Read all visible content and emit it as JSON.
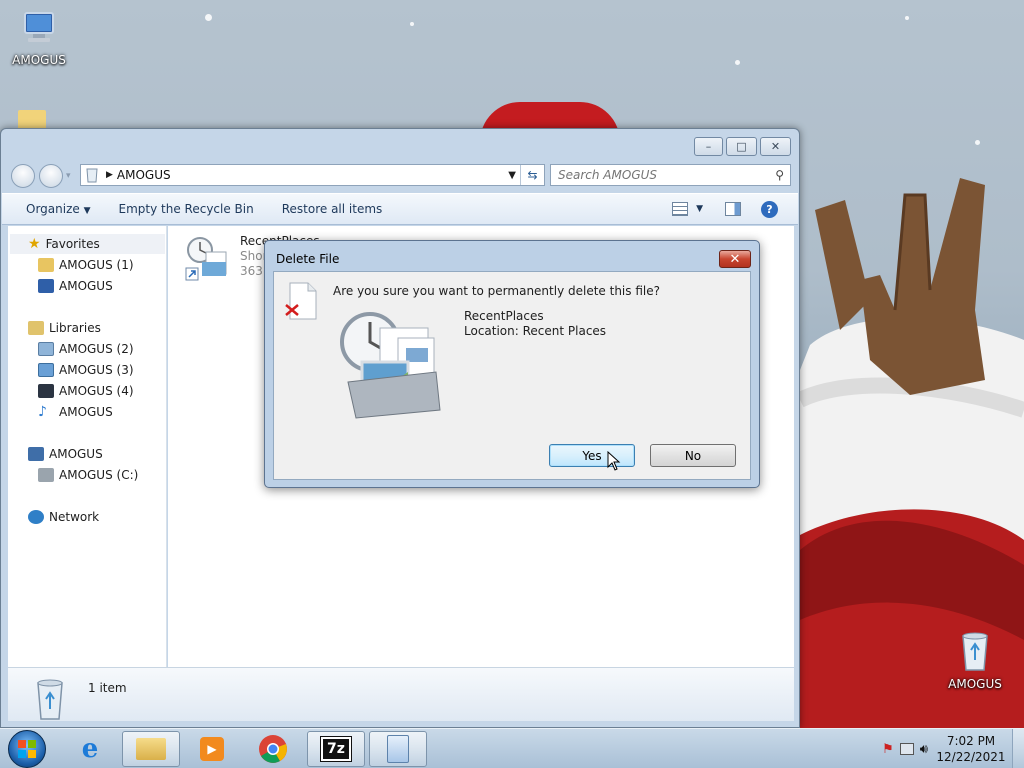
{
  "desktop": {
    "icons": [
      {
        "label": "AMOGUS",
        "kind": "computer"
      },
      {
        "label": "AMOGUS",
        "kind": "recycle-bin"
      }
    ]
  },
  "window": {
    "controls": {
      "minimize": "–",
      "maximize": "□",
      "close": "✕"
    },
    "address": {
      "breadcrumb": "AMOGUS"
    },
    "search": {
      "placeholder": "Search AMOGUS"
    },
    "commands": {
      "organize": "Organize",
      "empty_bin": "Empty the Recycle Bin",
      "restore_all": "Restore all items"
    },
    "nav": {
      "favorites": {
        "label": "Favorites",
        "items": [
          "AMOGUS (1)",
          "AMOGUS"
        ]
      },
      "libraries": {
        "label": "Libraries",
        "items": [
          "AMOGUS (2)",
          "AMOGUS (3)",
          "AMOGUS (4)",
          "AMOGUS"
        ]
      },
      "computer": {
        "label": "AMOGUS",
        "items": [
          "AMOGUS (C:)"
        ]
      },
      "network": {
        "label": "Network"
      }
    },
    "file": {
      "name": "RecentPlaces",
      "type": "Shorc",
      "size": "363 b"
    },
    "status": {
      "count": "1 item"
    }
  },
  "dialog": {
    "title": "Delete File",
    "close": "✕",
    "question": "Are you sure you want to permanently delete this file?",
    "file_name": "RecentPlaces",
    "location": "Location: Recent Places",
    "yes": "Yes",
    "no": "No"
  },
  "taskbar": {
    "start": "start-orb",
    "pinned": [
      "internet-explorer",
      "windows-explorer",
      "media-player",
      "chrome",
      "7-zip",
      "notepad"
    ],
    "clock": {
      "time": "7:02 PM",
      "date": "12/22/2021"
    }
  },
  "colors": {
    "accent": "#3c7fb1",
    "window_frame": "#c5d6e8",
    "close_red": "#c8452f"
  }
}
